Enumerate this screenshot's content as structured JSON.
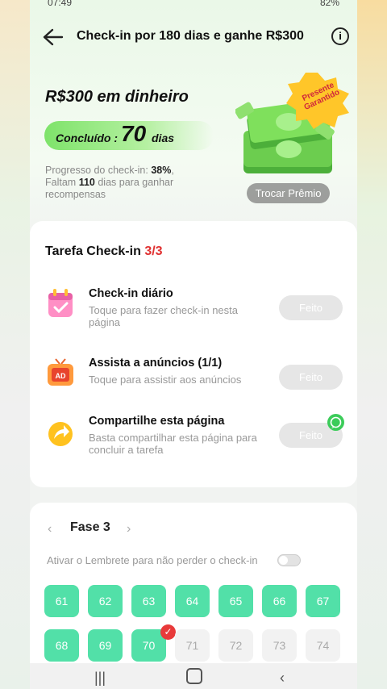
{
  "status": {
    "time": "07:49",
    "battery": "82%"
  },
  "header": {
    "title": "Check-in por 180 dias e ganhe R$300",
    "info_glyph": "i"
  },
  "prize": {
    "title": "R$300 em dinheiro",
    "done_label": "Concluído :",
    "done_days": "70",
    "done_unit": "dias",
    "progress_label": "Progresso do check-in:",
    "progress_pct": "38%",
    "remaining_prefix": "Faltam",
    "remaining_days": "110",
    "remaining_suffix": "dias para ganhar recompensas",
    "badge_line1": "Presente",
    "badge_line2": "Garantido",
    "swap_label": "Trocar Prêmio"
  },
  "tasks": {
    "heading": "Tarefa Check-in",
    "count": "3/3",
    "items": [
      {
        "name": "Check-in diário",
        "desc": "Toque para fazer check-in nesta página",
        "btn": "Feito"
      },
      {
        "name": "Assista a anúncios  (1/1)",
        "desc": "Toque para assistir aos anúncios",
        "btn": "Feito"
      },
      {
        "name": "Compartilhe esta página",
        "desc": "Basta compartilhar esta página para concluir a tarefa",
        "btn": "Feito"
      }
    ]
  },
  "phase": {
    "label": "Fase 3",
    "reminder": "Ativar o Lembrete para não perder o check-in",
    "days_row1": [
      "61",
      "62",
      "63",
      "64",
      "65",
      "66",
      "67"
    ],
    "days_row2": [
      "68",
      "69",
      "70",
      "71",
      "72",
      "73",
      "74"
    ],
    "completed_through": 70
  },
  "colors": {
    "accent_green": "#52e0a8",
    "red": "#e03030"
  }
}
